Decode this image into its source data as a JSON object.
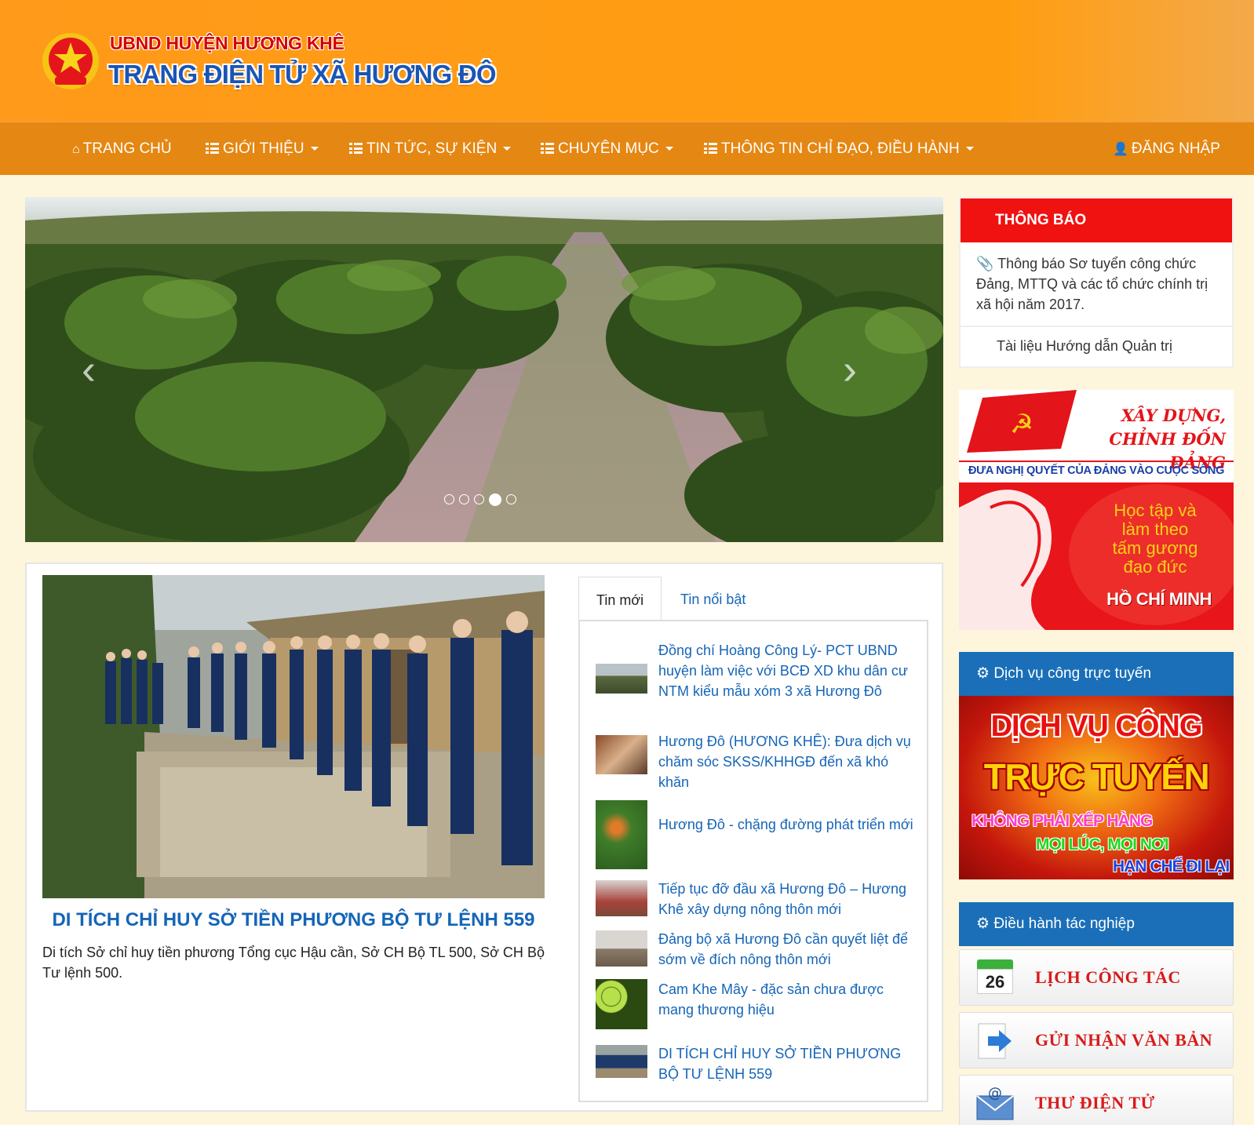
{
  "header": {
    "org": "UBND HUYỆN HƯƠNG KHÊ",
    "site_title": "TRANG ĐIỆN TỬ XÃ HƯƠNG ĐÔ"
  },
  "nav": {
    "home": "TRANG CHỦ",
    "about": "GIỚI THIỆU",
    "news": "TIN TỨC, SỰ KIỆN",
    "topics": "CHUYÊN MỤC",
    "directives": "THÔNG TIN CHỈ ĐẠO, ĐIỀU HÀNH",
    "login": "ĐĂNG NHẬP"
  },
  "slider": {
    "slide_count": 5,
    "active_slide": 4
  },
  "featured": {
    "title": "DI TÍCH CHỈ HUY SỞ TIỀN PHƯƠNG BỘ TƯ LỆNH 559",
    "description": "Di tích Sở chỉ huy tiền phương Tổng cục Hậu cần, Sở CH Bộ TL 500, Sở CH Bộ Tư lệnh 500."
  },
  "tabs": {
    "latest": "Tin mới",
    "featured": "Tin nổi bật"
  },
  "news": [
    "Đồng chí Hoàng Công Lý- PCT UBND huyện làm việc với BCĐ XD khu dân cư NTM kiểu mẫu xóm 3 xã Hương Đô",
    "Hương Đô (HƯƠNG KHÊ): Đưa dịch vụ chăm sóc SKSS/KHHGĐ đến xã khó khăn",
    "Hương Đô - chặng đường phát triển mới",
    "Tiếp tục đỡ đầu xã Hương Đô – Hương Khê xây dựng nông thôn mới",
    "Đảng bộ xã Hương Đô cần quyết liệt để sớm về đích nông thôn mới",
    "Cam Khe Mây - đặc sản chưa được mang thương hiệu",
    "DI TÍCH CHỈ HUY SỞ TIỀN PHƯƠNG BỘ TƯ LỆNH 559"
  ],
  "notice": {
    "title": "THÔNG BÁO",
    "items": [
      "Thông báo Sơ tuyển công chức Đảng, MTTQ và các tổ chức chính trị xã hội năm 2017.",
      "Tài liệu Hướng dẫn Quản trị"
    ]
  },
  "party_banner": {
    "line1": "XÂY DỰNG,",
    "line2": "CHỈNH ĐỐN ĐẢNG",
    "slogan": "ĐƯA NGHỊ QUYẾT CỦA ĐẢNG VÀO CUỘC SỐNG",
    "study1": "Học tập và",
    "study2": "làm theo",
    "study3": "tấm gương",
    "study4": "đạo đức",
    "name": "HỒ CHÍ MINH"
  },
  "online_services": {
    "heading": "Dịch vụ công trực tuyến",
    "banner_line1": "DỊCH VỤ CÔNG",
    "banner_line2": "TRỰC TUYẾN",
    "tag1": "KHÔNG PHẢI XẾP HÀNG",
    "tag2": "MỌI LÚC, MỌI NƠI",
    "tag3": "HẠN CHẾ ĐI LẠI"
  },
  "operations": {
    "heading": "Điều hành tác nghiệp",
    "calendar_day": "26",
    "items": [
      "LỊCH CÔNG TÁC",
      "GỬI NHẬN VĂN BẢN",
      "THƯ ĐIỆN TỬ"
    ]
  },
  "colors": {
    "header_orange": "#ff9a1a",
    "nav_orange": "#e58713",
    "notice_red": "#f01111",
    "box_blue": "#1a6fb8",
    "link_blue": "#1565b8"
  }
}
